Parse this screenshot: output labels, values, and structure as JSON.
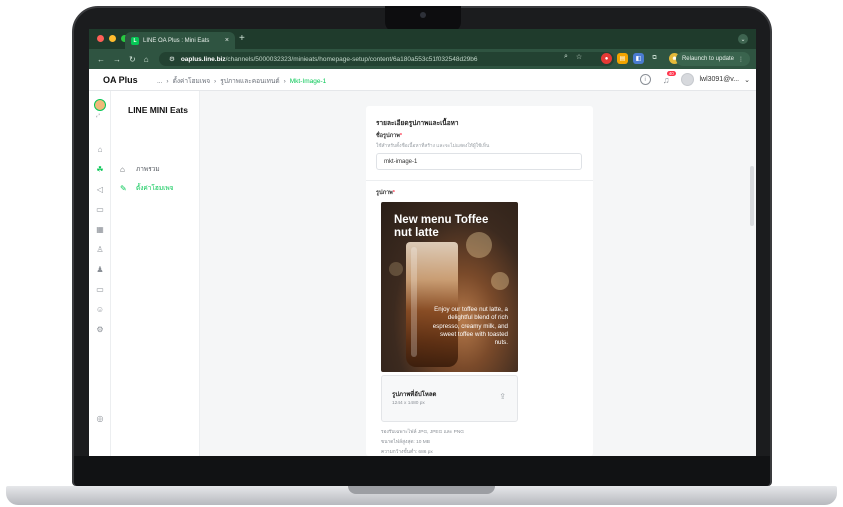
{
  "browser": {
    "tab_title": "LINE OA Plus : Mini Eats",
    "tab_close": "×",
    "new_tab": "+",
    "url_host": "oaplus.line.biz",
    "url_path": "/channels/5000032323/minieats/homepage-setup/content/6a180a553c51f032548d29b6",
    "relaunch_label": "Relaunch to update",
    "colors": {
      "frame": "#1f3b2c",
      "toolbar": "#2f5441"
    }
  },
  "header": {
    "brand": "OA Plus",
    "breadcrumb": [
      "...",
      "ตั้งค่าโฮมเพจ",
      "รูปภาพและคอนเทนต์",
      "Mkt-Image-1"
    ],
    "notification_count": "40",
    "account": "lwl3091@v..."
  },
  "rail": {
    "icons": [
      "home-icon",
      "coupon-icon",
      "megaphone-icon",
      "chat-icon",
      "table-icon",
      "users-icon",
      "person-icon",
      "card-icon",
      "robot-icon",
      "settings-icon",
      "help-icon"
    ]
  },
  "sidenav": {
    "title": "LINE MINI Eats",
    "items": [
      {
        "label": "ภาพรวม",
        "active": false
      },
      {
        "label": "ตั้งค่าโฮมเพจ",
        "active": true
      }
    ]
  },
  "form": {
    "section_title": "รายละเอียดรูปภาพและเนื้อหา",
    "name_label": "ชื่อรูปภาพ",
    "name_help": "ใช้สำหรับตั้งชื่อเนื้อหาที่สร้าง และจะไม่แสดงให้ผู้ใช้เห็น",
    "name_value": "mkt-image-1",
    "image_label": "รูปภาพ",
    "required_mark": "*",
    "image_headline": "New menu Toffee nut latte",
    "image_body": "Enjoy our toffee nut latte, a delightful blend of rich espresso, creamy milk, and sweet toffee with toasted nuts.",
    "upload_title": "รูปภาพที่อัปโหลด",
    "upload_size": "1244 x 1480 px",
    "notes": [
      "รองรับเฉพาะไฟล์ JPG, JPEG และ PNG",
      "ขนาดไฟล์สูงสุด: 10 MB",
      "ความกว้างขั้นต่ำ: 686 px"
    ]
  },
  "colors": {
    "accent": "#06c755",
    "badge": "#ff334b"
  }
}
